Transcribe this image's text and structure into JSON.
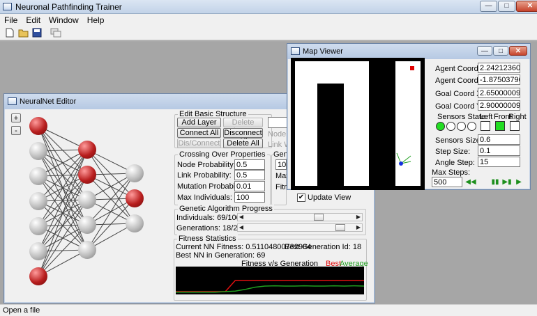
{
  "app": {
    "title": "Neuronal Pathfinding Trainer",
    "status": "Open a file"
  },
  "menu": [
    "File",
    "Edit",
    "Window",
    "Help"
  ],
  "toolbar_icons": [
    "new-file-icon",
    "open-folder-icon",
    "save-icon",
    "windows-icon"
  ],
  "window_buttons": {
    "minimize": "—",
    "maximize": "□",
    "close": "✕"
  },
  "editor": {
    "title": "NeuralNet Editor",
    "zoom_in": "+",
    "zoom_out": "-",
    "basic": {
      "legend": "Edit Basic Structure",
      "add_layer": "Add Layer",
      "delete_layer": "Delete Layer",
      "connect_all": "Connect All",
      "disconnect_all": "Disconnect All",
      "dis_connect": "Dis/Connect",
      "delete_all": "Delete All",
      "node_t": "Node T",
      "link_w": "Link We"
    },
    "crossover": {
      "legend": "Crossing Over Properties",
      "node_prob_label": "Node Probability:",
      "node_prob": "0.5",
      "link_prob_label": "Link Probability:",
      "link_prob": "0.5",
      "mut_prob_label": "Mutation Probability:",
      "mut_prob": "0.01",
      "max_ind_label": "Max Individuals:",
      "max_ind": "100"
    },
    "gen": {
      "legend": "Gene",
      "value": "10",
      "max_label": "Max",
      "fitn_label": "Fitn",
      "update_view": "Update View",
      "update_checked": "✔"
    },
    "progress": {
      "legend": "Genetic Algorithm Progress",
      "individuals_label": "Individuals: 69/100",
      "individuals_frac": 0.69,
      "generations_label": "Generations: 18/20",
      "generations_frac": 0.9
    },
    "fitness": {
      "legend": "Fitness Statistics",
      "current": "Current NN Fitness: 0.51104800732984",
      "best_gen_id": "Best Generation Id: 18",
      "best_in_gen": "Best NN in Generation: 69"
    }
  },
  "chart_data": {
    "type": "line",
    "title": "Fitness v/s Generation",
    "legend": [
      "Best",
      "Average"
    ],
    "colors": {
      "Best": "#e01010",
      "Average": "#1fa01f",
      "background": "#000000"
    },
    "x": [
      1,
      2,
      3,
      4,
      5,
      6,
      7,
      8,
      9,
      10,
      11,
      12,
      13,
      14,
      15,
      16,
      17,
      18,
      19,
      20
    ],
    "series": [
      {
        "name": "Best",
        "values": [
          0.1,
          0.1,
          0.1,
          0.1,
          0.1,
          0.1,
          0.5,
          0.5,
          0.5,
          0.5,
          0.5,
          0.5,
          0.5,
          0.5,
          0.5,
          0.5,
          0.5,
          0.5,
          0.5,
          0.5
        ]
      },
      {
        "name": "Average",
        "values": [
          0.08,
          0.08,
          0.08,
          0.08,
          0.08,
          0.1,
          0.12,
          0.18,
          0.26,
          0.3,
          0.31,
          0.3,
          0.3,
          0.31,
          0.3,
          0.3,
          0.31,
          0.3,
          0.31,
          0.3
        ]
      }
    ],
    "ylim": [
      0,
      1
    ]
  },
  "network": {
    "layers": [
      [
        "red",
        "grey",
        "grey",
        "grey",
        "grey",
        "grey",
        "red"
      ],
      [
        "red",
        "red",
        "grey",
        "grey",
        "grey"
      ],
      [
        "grey",
        "red",
        "grey"
      ]
    ]
  },
  "map": {
    "title": "Map Viewer",
    "agent_x_label": "Agent Coord X:",
    "agent_x": "2.24212360382",
    "agent_y_label": "Agent Coord Y:",
    "agent_y": "-1.8750379085",
    "goal_x_label": "Goal Coord X:",
    "goal_x": "2.65000009536",
    "goal_y_label": "Goal Coord Y:",
    "goal_y": "2.90000009536",
    "sensors_state": "Sensors State",
    "left": "Left",
    "front": "Front",
    "right": "Right",
    "sensors_size_label": "Sensors Size:",
    "sensors_size": "0.6",
    "step_size_label": "Step Size:",
    "step_size": "0.1",
    "angle_step_label": "Angle Step:",
    "angle_step": "15",
    "max_steps_label": "Max Steps:",
    "max_steps": "500",
    "playback": [
      "rewind-icon",
      "pause-icon",
      "step-forward-icon",
      "play-icon"
    ],
    "playback_glyphs": [
      "◀◀",
      "▮▮",
      "▶▮",
      "▶"
    ],
    "sensor_states": [
      true,
      false,
      false,
      false
    ],
    "direction_states": [
      false,
      true,
      false
    ]
  }
}
